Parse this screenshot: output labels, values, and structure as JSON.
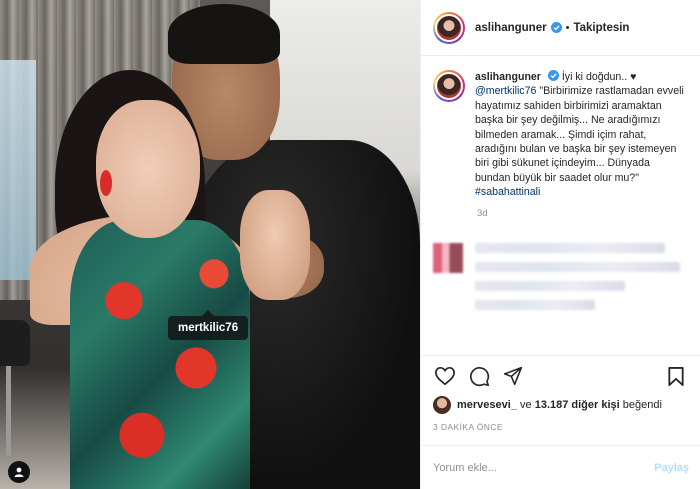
{
  "post": {
    "tagged_user": "mertkilic76",
    "header": {
      "username": "aslihanguner",
      "separator": "•",
      "follow_label": "Takiptesin"
    },
    "caption": {
      "username": "aslihanguner",
      "intro": "İyi ki doğdun.. ♥",
      "mention": "@mertkilic76",
      "body": "\"Birbirimize rastlamadan evveli hayatımız sahiden birbirimizi aramaktan başka bir şey değilmiş... Ne aradığımızı bilmeden aramak... Şimdi içim rahat, aradığını bulan ve başka bir şey istemeyen biri gibi sükunet içindeyim... Dünyada bundan büyük bir saadet olur mu?\"",
      "hashtag": "#sabahattinali",
      "age": "3d"
    },
    "likes": {
      "first_user": "mervesevi_",
      "connector": "ve",
      "others": "13.187 diğer kişi",
      "suffix": "beğendi"
    },
    "time_ago": "3 DAKİKA ÖNCE",
    "comment": {
      "placeholder": "Yorum ekle...",
      "post_label": "Paylaş"
    },
    "icons": {
      "like": "heart-icon",
      "comment": "comment-icon",
      "share": "share-icon",
      "save": "bookmark-icon",
      "verified": "verified-badge-icon"
    },
    "colors": {
      "verified": "#3897f0",
      "link": "#003569",
      "post_button_disabled": "#b2dffc"
    }
  }
}
